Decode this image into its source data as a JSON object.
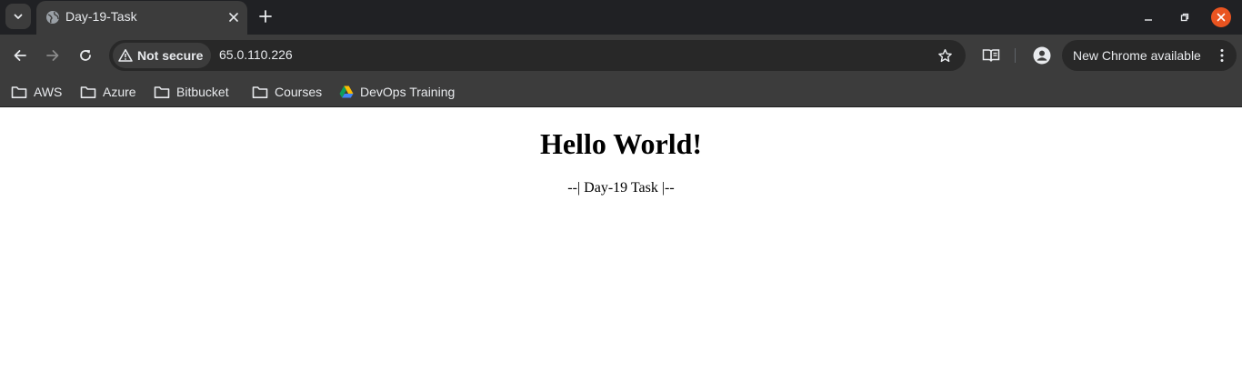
{
  "window": {
    "tab_title": "Day-19-Task"
  },
  "toolbar": {
    "security_label": "Not secure",
    "url": "65.0.110.226",
    "update_label": "New Chrome available"
  },
  "bookmarks": [
    {
      "label": "AWS",
      "icon": "folder-icon"
    },
    {
      "label": "Azure",
      "icon": "folder-icon"
    },
    {
      "label": "Bitbucket",
      "icon": "folder-icon"
    },
    {
      "label": "Courses",
      "icon": "folder-icon"
    },
    {
      "label": "DevOps Training",
      "icon": "google-drive-icon"
    }
  ],
  "page": {
    "heading": "Hello World!",
    "subtitle": "--| Day-19 Task |--"
  },
  "colors": {
    "chrome_dark": "#202124",
    "chrome_toolbar": "#3c3c3c",
    "omnibox": "#282828",
    "close_button": "#e95420",
    "page_background": "#ffffff"
  }
}
